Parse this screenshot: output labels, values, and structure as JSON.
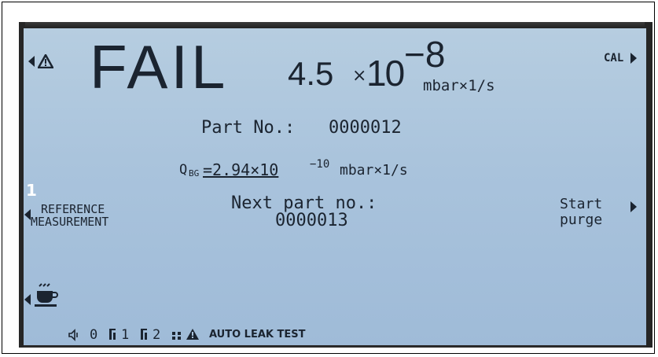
{
  "status": {
    "result": "FAIL",
    "mantissa": "4.5",
    "times": "×",
    "base": "10",
    "exponent": "−8",
    "unit": "mbar×1/s",
    "cal_label": "CAL"
  },
  "part": {
    "label": "Part No.:",
    "number": "0000012"
  },
  "background": {
    "symbol": "Q",
    "subscript": "BG",
    "value": "=2.94×10",
    "exponent": "−10",
    "unit": "mbar×1/s"
  },
  "softkeys": {
    "marker": "1",
    "left_line1": "REFERENCE",
    "left_line2": "MEASUREMENT",
    "center_line1": "Next part no.:",
    "center_line2": "0000013",
    "right_line1": "Start",
    "right_line2": "purge"
  },
  "statusbar": {
    "zero_label": "0",
    "ch1_label": "1",
    "ch2_label": "2",
    "mode_text": "AUTO LEAK TEST"
  },
  "colors": {
    "lcd_background": "#a9c3dc",
    "lcd_text": "#1b2430"
  }
}
